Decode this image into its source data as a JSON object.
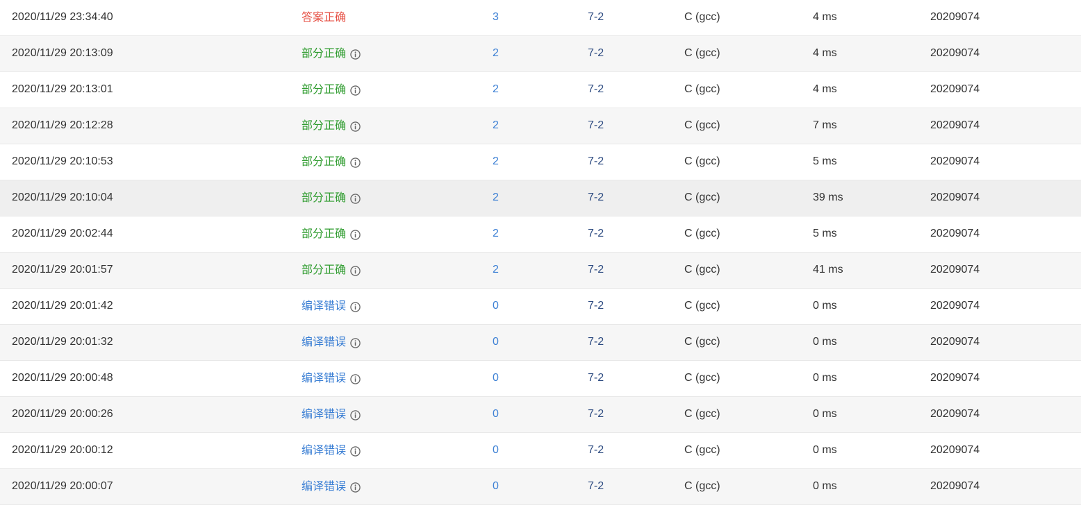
{
  "colors": {
    "accepted": "#e54b3f",
    "partial": "#2f9c2f",
    "compile_error": "#3b7fd4",
    "score_link": "#3b7fd4",
    "problem_link": "#2c4a80"
  },
  "rows": [
    {
      "submit_time": "2020/11/29 23:34:40",
      "status": "答案正确",
      "status_type": "ok",
      "has_info": false,
      "score": "3",
      "problem": "7-2",
      "language": "C (gcc)",
      "time_used": "4 ms",
      "user": "20209074"
    },
    {
      "submit_time": "2020/11/29 20:13:09",
      "status": "部分正确",
      "status_type": "partial",
      "has_info": true,
      "score": "2",
      "problem": "7-2",
      "language": "C (gcc)",
      "time_used": "4 ms",
      "user": "20209074"
    },
    {
      "submit_time": "2020/11/29 20:13:01",
      "status": "部分正确",
      "status_type": "partial",
      "has_info": true,
      "score": "2",
      "problem": "7-2",
      "language": "C (gcc)",
      "time_used": "4 ms",
      "user": "20209074"
    },
    {
      "submit_time": "2020/11/29 20:12:28",
      "status": "部分正确",
      "status_type": "partial",
      "has_info": true,
      "score": "2",
      "problem": "7-2",
      "language": "C (gcc)",
      "time_used": "7 ms",
      "user": "20209074"
    },
    {
      "submit_time": "2020/11/29 20:10:53",
      "status": "部分正确",
      "status_type": "partial",
      "has_info": true,
      "score": "2",
      "problem": "7-2",
      "language": "C (gcc)",
      "time_used": "5 ms",
      "user": "20209074"
    },
    {
      "submit_time": "2020/11/29 20:10:04",
      "status": "部分正确",
      "status_type": "partial",
      "has_info": true,
      "score": "2",
      "problem": "7-2",
      "language": "C (gcc)",
      "time_used": "39 ms",
      "user": "20209074"
    },
    {
      "submit_time": "2020/11/29 20:02:44",
      "status": "部分正确",
      "status_type": "partial",
      "has_info": true,
      "score": "2",
      "problem": "7-2",
      "language": "C (gcc)",
      "time_used": "5 ms",
      "user": "20209074"
    },
    {
      "submit_time": "2020/11/29 20:01:57",
      "status": "部分正确",
      "status_type": "partial",
      "has_info": true,
      "score": "2",
      "problem": "7-2",
      "language": "C (gcc)",
      "time_used": "41 ms",
      "user": "20209074"
    },
    {
      "submit_time": "2020/11/29 20:01:42",
      "status": "编译错误",
      "status_type": "ce",
      "has_info": true,
      "score": "0",
      "problem": "7-2",
      "language": "C (gcc)",
      "time_used": "0 ms",
      "user": "20209074"
    },
    {
      "submit_time": "2020/11/29 20:01:32",
      "status": "编译错误",
      "status_type": "ce",
      "has_info": true,
      "score": "0",
      "problem": "7-2",
      "language": "C (gcc)",
      "time_used": "0 ms",
      "user": "20209074"
    },
    {
      "submit_time": "2020/11/29 20:00:48",
      "status": "编译错误",
      "status_type": "ce",
      "has_info": true,
      "score": "0",
      "problem": "7-2",
      "language": "C (gcc)",
      "time_used": "0 ms",
      "user": "20209074"
    },
    {
      "submit_time": "2020/11/29 20:00:26",
      "status": "编译错误",
      "status_type": "ce",
      "has_info": true,
      "score": "0",
      "problem": "7-2",
      "language": "C (gcc)",
      "time_used": "0 ms",
      "user": "20209074"
    },
    {
      "submit_time": "2020/11/29 20:00:12",
      "status": "编译错误",
      "status_type": "ce",
      "has_info": true,
      "score": "0",
      "problem": "7-2",
      "language": "C (gcc)",
      "time_used": "0 ms",
      "user": "20209074"
    },
    {
      "submit_time": "2020/11/29 20:00:07",
      "status": "编译错误",
      "status_type": "ce",
      "has_info": true,
      "score": "0",
      "problem": "7-2",
      "language": "C (gcc)",
      "time_used": "0 ms",
      "user": "20209074"
    }
  ]
}
